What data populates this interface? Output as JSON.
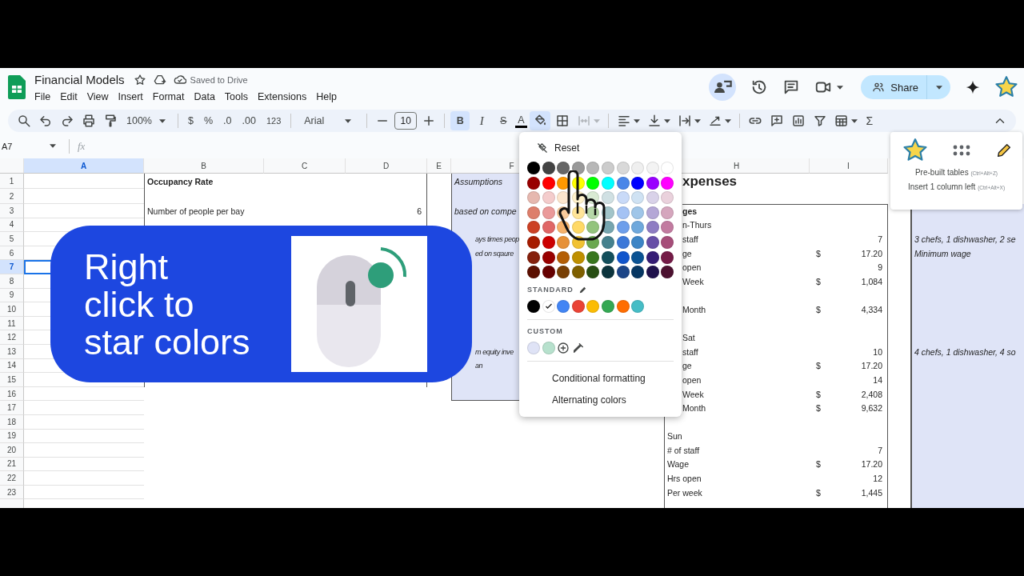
{
  "app": {
    "title": "Financial Models",
    "save_status": "Saved to Drive",
    "menu": [
      "File",
      "Edit",
      "View",
      "Insert",
      "Format",
      "Data",
      "Tools",
      "Extensions",
      "Help"
    ],
    "share_label": "Share"
  },
  "toolbar": {
    "zoom": "100%",
    "currency": "$",
    "percent": "%",
    "decrease_decimals": ".0",
    "increase_decimals": ".00",
    "number_format": "123",
    "font": "Arial",
    "font_size": "10",
    "bold": {
      "label": "B",
      "selected": true
    },
    "italic": {
      "label": "I",
      "selected": false
    },
    "strikethrough": {
      "label": "S",
      "selected": false
    },
    "text_color": "A",
    "fill_color": {
      "selected": true
    },
    "merge": {
      "disabled": true
    },
    "functions": "Σ"
  },
  "formula_bar": {
    "cell_ref": "A7",
    "formula_label": "fx"
  },
  "sheet": {
    "columns": [
      {
        "label": "A",
        "selected": true
      },
      {
        "label": "B",
        "selected": false
      },
      {
        "label": "C",
        "selected": false
      },
      {
        "label": "D",
        "selected": false
      },
      {
        "label": "E",
        "selected": false
      },
      {
        "label": "F",
        "selected": false
      },
      {
        "label": "H",
        "selected": false
      },
      {
        "label": "I",
        "selected": false
      }
    ],
    "rows": [
      {
        "number": "1",
        "selected": false,
        "cells": {
          "b": {
            "text": "Occupancy Rate",
            "kind": "bold"
          },
          "f": {
            "text": "Assumptions",
            "kind": "italic"
          },
          "h": {
            "text": "xpenses",
            "kind": "title"
          }
        }
      },
      {
        "number": "2",
        "selected": false,
        "cells": {}
      },
      {
        "number": "3",
        "selected": false,
        "cells": {
          "b": {
            "text": "Number of people per bay",
            "kind": "plain"
          },
          "d": {
            "text": "6",
            "kind": "number"
          },
          "f": {
            "text": "based on compe",
            "kind": "italic"
          },
          "h": {
            "text": "ges",
            "kind": "bold"
          }
        }
      },
      {
        "number": "4",
        "selected": false,
        "cells": {
          "h": {
            "text": "n-Thurs",
            "kind": "plain"
          }
        }
      },
      {
        "number": "5",
        "selected": false,
        "cells": {
          "f": {
            "text": "ays times peop",
            "kind": "italic"
          },
          "h": {
            "text": "staff",
            "kind": "plain"
          },
          "i": {
            "text": "7",
            "kind": "number"
          },
          "k": {
            "text": "3 chefs, 1 dishwasher, 2 se",
            "kind": "italic"
          }
        }
      },
      {
        "number": "6",
        "selected": false,
        "cells": {
          "f": {
            "text": "ed on sqaure",
            "kind": "italic"
          },
          "h": {
            "text": "ge",
            "kind": "plain"
          },
          "i": {
            "text": "17.20",
            "kind": "number",
            "currency": "$"
          },
          "k": {
            "text": "Minimum wage",
            "kind": "italic"
          }
        }
      },
      {
        "number": "7",
        "selected": true,
        "cells": {
          "h": {
            "text": "open",
            "kind": "plain"
          },
          "i": {
            "text": "9",
            "kind": "number"
          }
        }
      },
      {
        "number": "8",
        "selected": false,
        "cells": {
          "h": {
            "text": "Week",
            "kind": "plain"
          },
          "i": {
            "text": "1,084",
            "kind": "number",
            "currency": "$"
          }
        }
      },
      {
        "number": "9",
        "selected": false,
        "cells": {}
      },
      {
        "number": "10",
        "selected": false,
        "cells": {
          "h": {
            "text": "Month",
            "kind": "plain"
          },
          "i": {
            "text": "4,334",
            "kind": "number",
            "currency": "$"
          }
        }
      },
      {
        "number": "11",
        "selected": false,
        "cells": {}
      },
      {
        "number": "12",
        "selected": false,
        "cells": {
          "h": {
            "text": "Sat",
            "kind": "plain"
          }
        }
      },
      {
        "number": "13",
        "selected": false,
        "cells": {
          "f": {
            "text": "m equity inve",
            "kind": "italic"
          },
          "h": {
            "text": "staff",
            "kind": "plain"
          },
          "i": {
            "text": "10",
            "kind": "number"
          },
          "k": {
            "text": "4 chefs, 1 dishwasher, 4 so",
            "kind": "italic"
          }
        }
      },
      {
        "number": "14",
        "selected": false,
        "cells": {
          "f": {
            "text": "an",
            "kind": "italic"
          },
          "h": {
            "text": "ge",
            "kind": "plain"
          },
          "i": {
            "text": "17.20",
            "kind": "number",
            "currency": "$"
          }
        }
      },
      {
        "number": "15",
        "selected": false,
        "cells": {
          "h": {
            "text": "open",
            "kind": "plain"
          },
          "i": {
            "text": "14",
            "kind": "number"
          }
        }
      },
      {
        "number": "16",
        "selected": false,
        "cells": {
          "h": {
            "text": "Week",
            "kind": "plain"
          },
          "i": {
            "text": "2,408",
            "kind": "number",
            "currency": "$"
          }
        }
      },
      {
        "number": "17",
        "selected": false,
        "cells": {
          "h": {
            "text": "Month",
            "kind": "plain"
          },
          "i": {
            "text": "9,632",
            "kind": "number",
            "currency": "$"
          }
        }
      },
      {
        "number": "18",
        "selected": false,
        "cells": {}
      },
      {
        "number": "19",
        "selected": false,
        "cells": {
          "h": {
            "text": "Sun",
            "kind": "plain"
          }
        }
      },
      {
        "number": "20",
        "selected": false,
        "cells": {
          "h": {
            "text": "# of staff",
            "kind": "plain"
          },
          "i": {
            "text": "7",
            "kind": "number"
          }
        }
      },
      {
        "number": "21",
        "selected": false,
        "cells": {
          "h": {
            "text": "Wage",
            "kind": "plain"
          },
          "i": {
            "text": "17.20",
            "kind": "number",
            "currency": "$"
          }
        }
      },
      {
        "number": "22",
        "selected": false,
        "cells": {
          "h": {
            "text": "Hrs open",
            "kind": "plain"
          },
          "i": {
            "text": "12",
            "kind": "number"
          }
        }
      },
      {
        "number": "23",
        "selected": false,
        "cells": {
          "h": {
            "text": "Per week",
            "kind": "plain"
          },
          "i": {
            "text": "1,445",
            "kind": "number",
            "currency": "$"
          }
        }
      }
    ]
  },
  "fill_menu": {
    "reset": "Reset",
    "palette": [
      {
        "swatches": [
          {
            "color": "#000000"
          },
          {
            "color": "#434343"
          },
          {
            "color": "#666666"
          },
          {
            "color": "#999999"
          },
          {
            "color": "#b7b7b7"
          },
          {
            "color": "#cccccc"
          },
          {
            "color": "#d9d9d9"
          },
          {
            "color": "#efefef"
          },
          {
            "color": "#f3f3f3"
          },
          {
            "color": "#ffffff"
          }
        ]
      },
      {
        "swatches": [
          {
            "color": "#980000"
          },
          {
            "color": "#ff0000"
          },
          {
            "color": "#ff9900"
          },
          {
            "color": "#ffff00"
          },
          {
            "color": "#00ff00"
          },
          {
            "color": "#00ffff"
          },
          {
            "color": "#4a86e8"
          },
          {
            "color": "#0000ff"
          },
          {
            "color": "#9900ff"
          },
          {
            "color": "#ff00ff"
          }
        ]
      },
      {
        "swatches": [
          {
            "color": "#e6b8af"
          },
          {
            "color": "#f4cccc"
          },
          {
            "color": "#fce5cd"
          },
          {
            "color": "#fff2cc"
          },
          {
            "color": "#d9ead3"
          },
          {
            "color": "#d0e0e3"
          },
          {
            "color": "#c9daf8"
          },
          {
            "color": "#cfe2f3"
          },
          {
            "color": "#d9d2e9"
          },
          {
            "color": "#ead1dc"
          }
        ]
      },
      {
        "swatches": [
          {
            "color": "#dd7e6b"
          },
          {
            "color": "#ea9999"
          },
          {
            "color": "#f9cb9c"
          },
          {
            "color": "#ffe599"
          },
          {
            "color": "#b6d7a8"
          },
          {
            "color": "#a2c4c9"
          },
          {
            "color": "#a4c2f4"
          },
          {
            "color": "#9fc5e8"
          },
          {
            "color": "#b4a7d6"
          },
          {
            "color": "#d5a6bd"
          }
        ]
      },
      {
        "swatches": [
          {
            "color": "#cc4125"
          },
          {
            "color": "#e06666"
          },
          {
            "color": "#f6b26b"
          },
          {
            "color": "#ffd966"
          },
          {
            "color": "#93c47d"
          },
          {
            "color": "#76a5af"
          },
          {
            "color": "#6d9eeb"
          },
          {
            "color": "#6fa8dc"
          },
          {
            "color": "#8e7cc3"
          },
          {
            "color": "#c27ba0"
          }
        ]
      },
      {
        "swatches": [
          {
            "color": "#a61c00"
          },
          {
            "color": "#cc0000"
          },
          {
            "color": "#e69138"
          },
          {
            "color": "#f1c232"
          },
          {
            "color": "#6aa84f"
          },
          {
            "color": "#45818e"
          },
          {
            "color": "#3c78d8"
          },
          {
            "color": "#3d85c6"
          },
          {
            "color": "#674ea7"
          },
          {
            "color": "#a64d79"
          }
        ]
      },
      {
        "swatches": [
          {
            "color": "#85200c"
          },
          {
            "color": "#990000"
          },
          {
            "color": "#b45f06"
          },
          {
            "color": "#bf9000"
          },
          {
            "color": "#38761d"
          },
          {
            "color": "#134f5c"
          },
          {
            "color": "#1155cc"
          },
          {
            "color": "#0b5394"
          },
          {
            "color": "#351c75"
          },
          {
            "color": "#741b47"
          }
        ]
      },
      {
        "swatches": [
          {
            "color": "#5b0f00"
          },
          {
            "color": "#660000"
          },
          {
            "color": "#783f04"
          },
          {
            "color": "#7f6000"
          },
          {
            "color": "#274e13"
          },
          {
            "color": "#0c343d"
          },
          {
            "color": "#1c4587"
          },
          {
            "color": "#073763"
          },
          {
            "color": "#20124d"
          },
          {
            "color": "#4c1130"
          }
        ]
      }
    ],
    "standard_label": "STANDARD",
    "standard": [
      {
        "color": "#000000",
        "selected": false
      },
      {
        "color": "#ffffff",
        "selected": true
      },
      {
        "color": "#4285f4",
        "selected": false
      },
      {
        "color": "#ea4335",
        "selected": false
      },
      {
        "color": "#fbbc04",
        "selected": false
      },
      {
        "color": "#34a853",
        "selected": false
      },
      {
        "color": "#ff6d01",
        "selected": false
      },
      {
        "color": "#46bdc6",
        "selected": false
      }
    ],
    "custom_label": "CUSTOM",
    "custom": [
      {
        "color": "#dfe3f6"
      },
      {
        "color": "#b7e1cd"
      }
    ],
    "actions": [
      "Conditional formatting",
      "Alternating colors"
    ]
  },
  "banner": {
    "lines": [
      "Right",
      "click to",
      "star colors"
    ]
  },
  "side_popup": {
    "items": [
      {
        "label": "Pre-built tables",
        "shortcut": "(Ctrl+Alt+Z)"
      },
      {
        "label": "Insert 1 column left",
        "shortcut": "(Ctrl+Alt+X)"
      }
    ]
  }
}
